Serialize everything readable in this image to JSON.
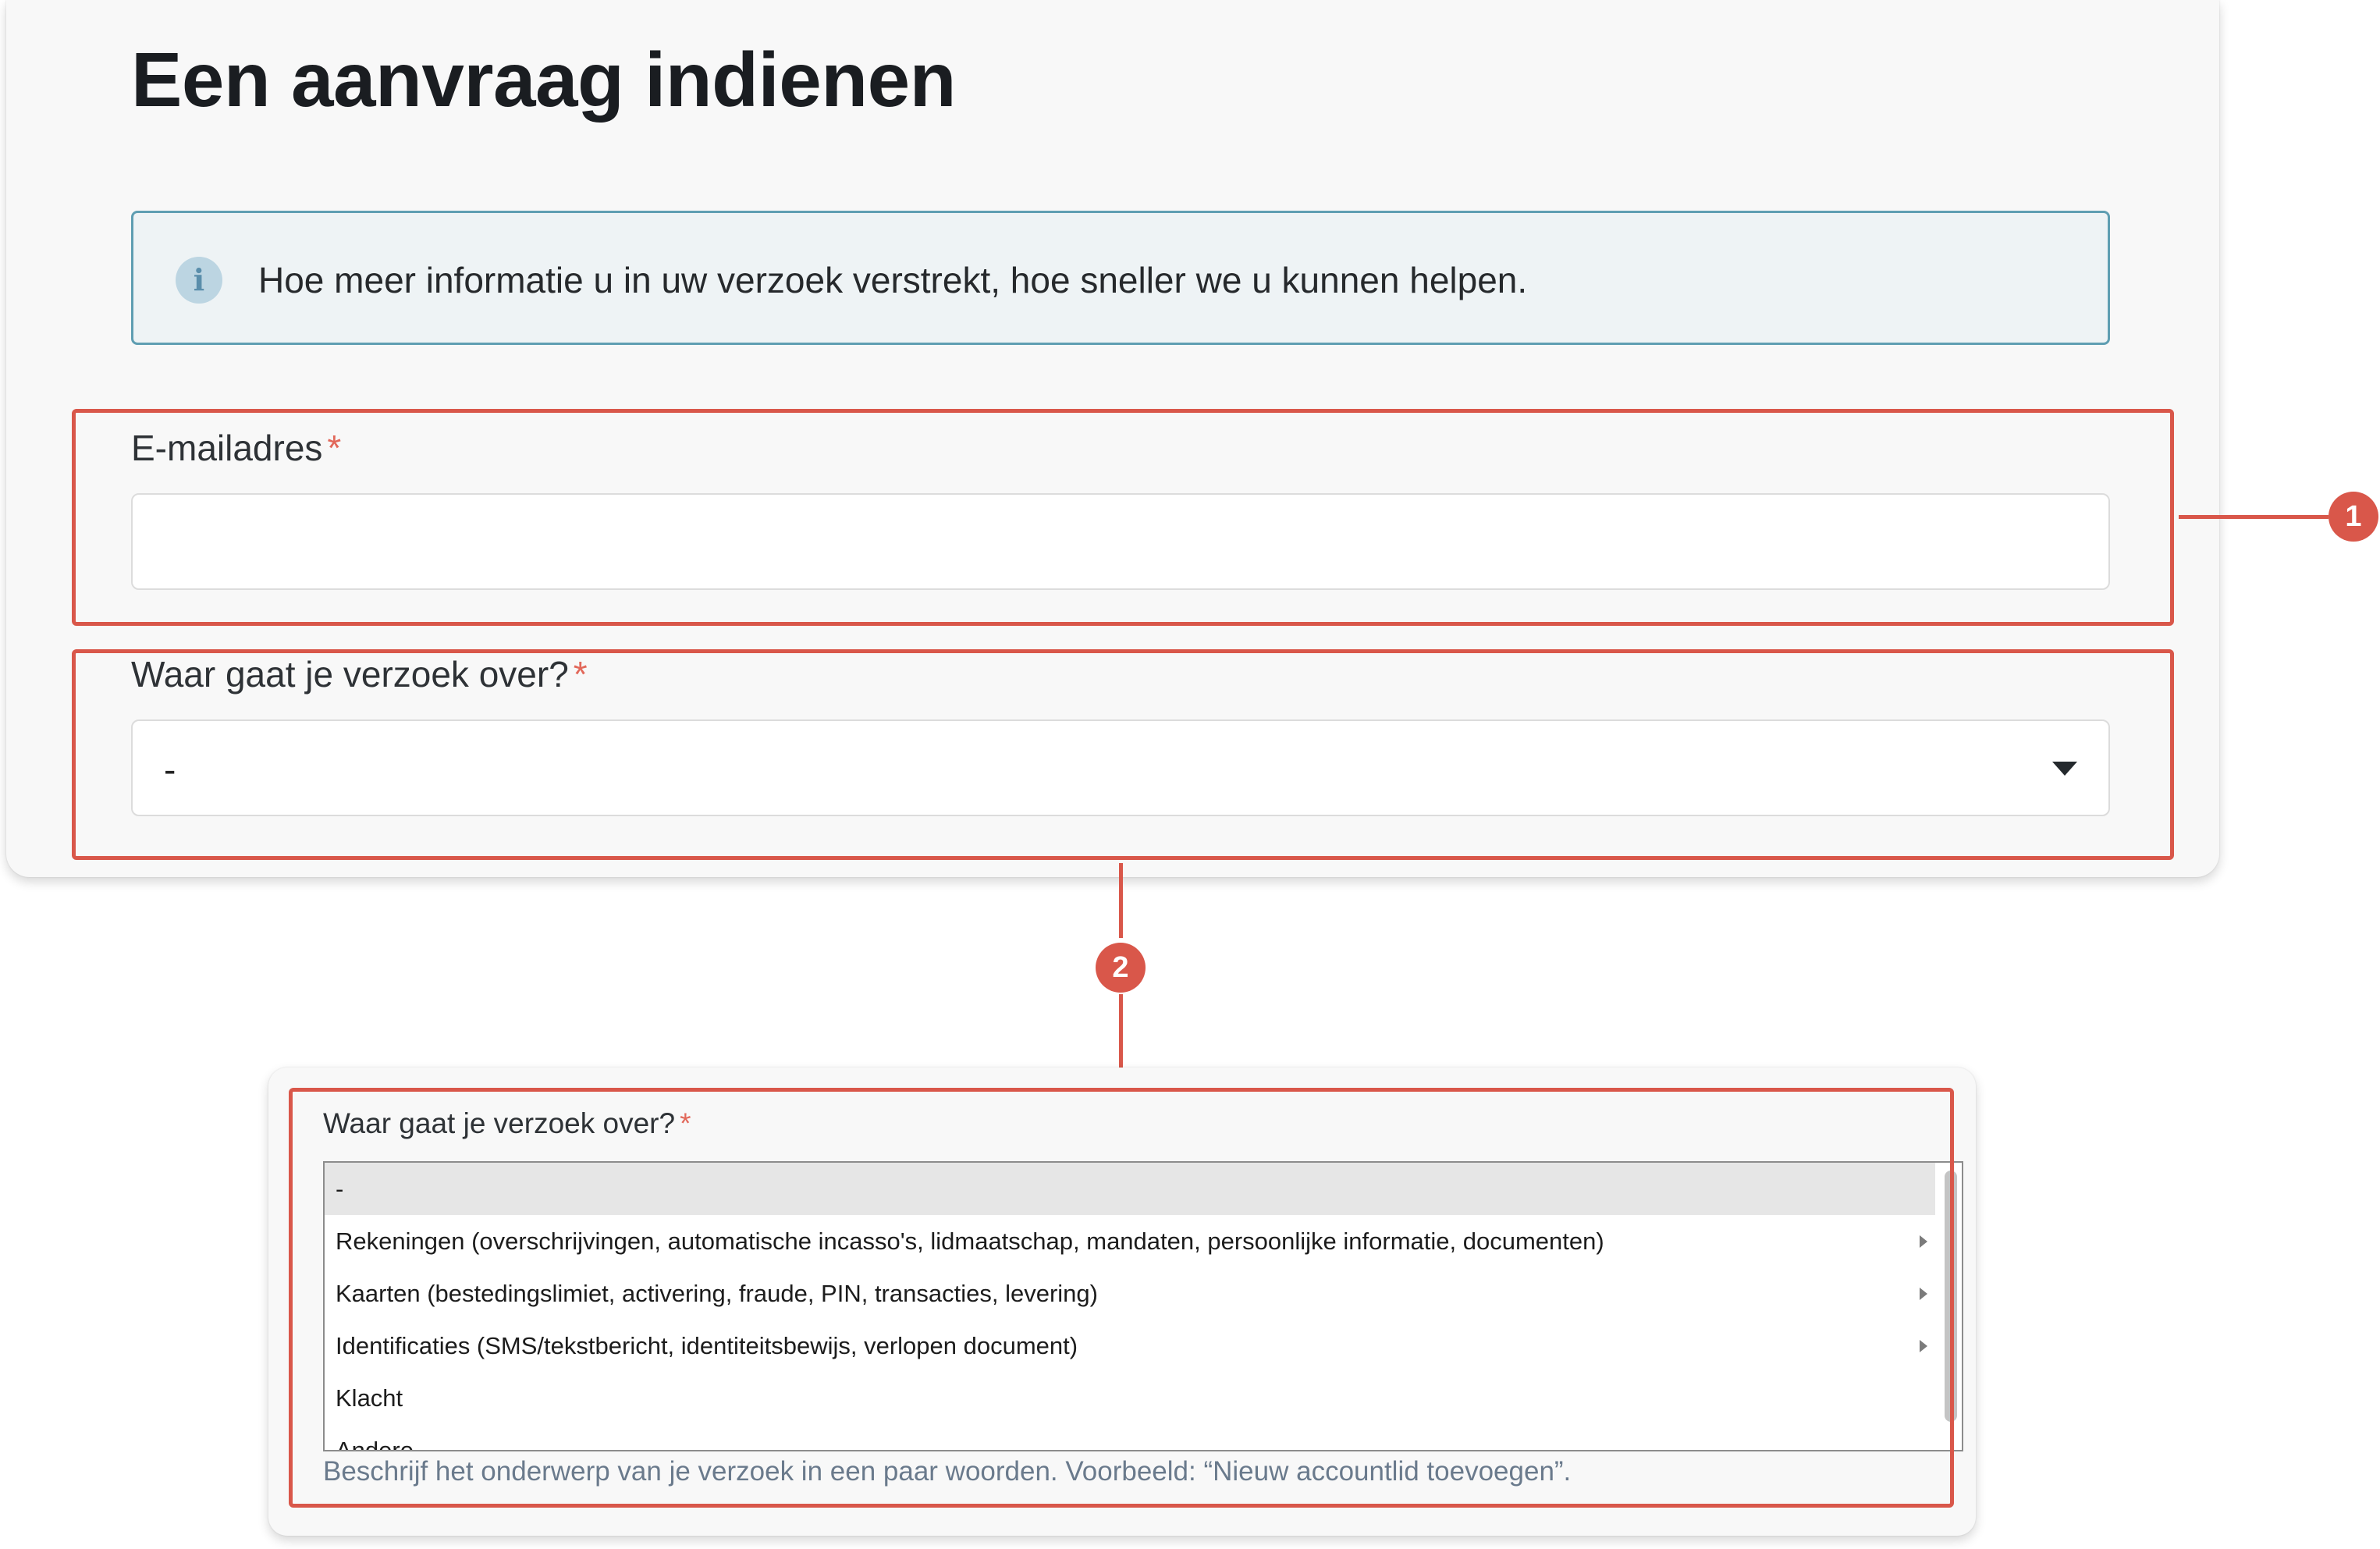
{
  "form": {
    "title": "Een aanvraag indienen",
    "info_message": "Hoe meer informatie u in uw verzoek verstrekt, hoe sneller we u kunnen helpen.",
    "info_icon": "info-icon",
    "email": {
      "label": "E-mailadres",
      "required_mark": "*",
      "value": ""
    },
    "topic": {
      "label": "Waar gaat je verzoek over?",
      "required_mark": "*",
      "selected_value": "-"
    }
  },
  "expanded_topic": {
    "label": "Waar gaat je verzoek over?",
    "required_mark": "*",
    "options": [
      {
        "label": "-",
        "has_submenu": false,
        "selected": true
      },
      {
        "label": "Rekeningen (overschrijvingen, automatische incasso's, lidmaatschap, mandaten, persoonlijke informatie, documenten)",
        "has_submenu": true,
        "selected": false
      },
      {
        "label": "Kaarten (bestedingslimiet, activering, fraude, PIN, transacties, levering)",
        "has_submenu": true,
        "selected": false
      },
      {
        "label": "Identificaties (SMS/tekstbericht, identiteitsbewijs, verlopen document)",
        "has_submenu": true,
        "selected": false
      },
      {
        "label": "Klacht",
        "has_submenu": false,
        "selected": false
      },
      {
        "label": "Andere",
        "has_submenu": false,
        "selected": false
      }
    ],
    "hint": "Beschrijf het onderwerp van je verzoek in een paar woorden. Voorbeeld: “Nieuw accountlid toevoegen”."
  },
  "annotations": {
    "callout_1": "1",
    "callout_2": "2",
    "highlight_color": "#d9574a"
  },
  "colors": {
    "required": "#e2685a",
    "info_border": "#5f9eb2",
    "info_background": "#eef3f5"
  }
}
